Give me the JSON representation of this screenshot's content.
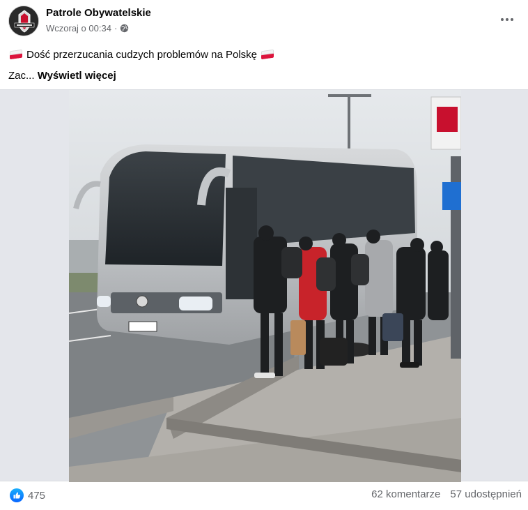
{
  "post": {
    "author": "Patrole Obywatelskie",
    "timestamp": "Wczoraj o 00:34",
    "separator": "·",
    "privacy_icon": "globe-icon",
    "text_line1": "Dość przerzucania cudzych problemów na Polskę",
    "text_line2_prefix": "Zac...",
    "see_more": "Wyświetl więcej",
    "flag_icon": "poland-flag-icon"
  },
  "photo": {
    "bus_plate": "OE 9 9059"
  },
  "footer": {
    "reaction_icon": "like-icon",
    "reaction_count": "475",
    "comments": "62 komentarze",
    "shares": "57 udostępnień"
  },
  "colors": {
    "accent": "#0866ff",
    "secondary_text": "#65676b",
    "flag_red": "#dc143c"
  }
}
